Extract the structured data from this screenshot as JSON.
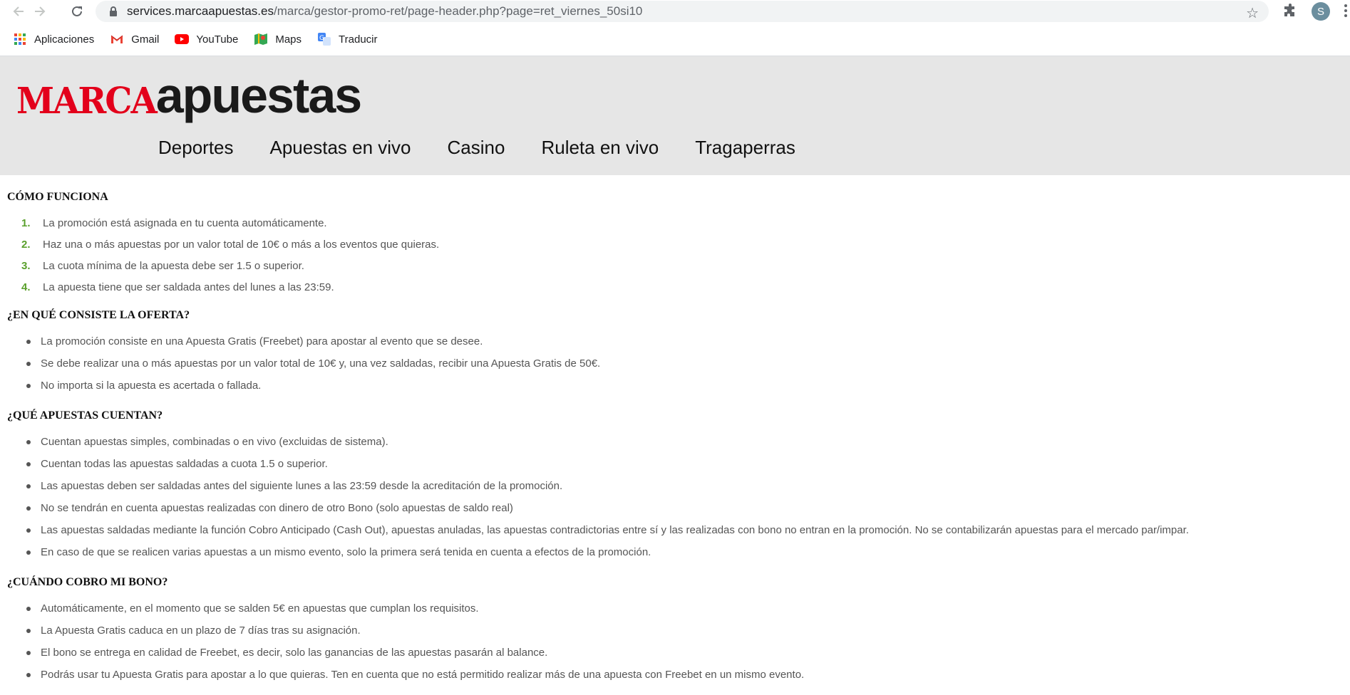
{
  "browser": {
    "url_host": "services.marcaapuestas.es",
    "url_path": "/marca/gestor-promo-ret/page-header.php?page=ret_viernes_50si10",
    "profile_initial": "S",
    "icons": [
      "back-arrow-icon",
      "forward-arrow-icon",
      "reload-icon",
      "lock-icon",
      "star-icon",
      "extensions-icon",
      "menu-kebab-icon"
    ]
  },
  "bookmarks": [
    {
      "label": "Aplicaciones",
      "icon": "apps-grid-icon"
    },
    {
      "label": "Gmail",
      "icon": "gmail-icon"
    },
    {
      "label": "YouTube",
      "icon": "youtube-icon"
    },
    {
      "label": "Maps",
      "icon": "maps-icon"
    },
    {
      "label": "Traducir",
      "icon": "translate-icon"
    }
  ],
  "site": {
    "logo_part1": "MARCA",
    "logo_part2": "apuestas",
    "menu": [
      "Deportes",
      "Apuestas en vivo",
      "Casino",
      "Ruleta en vivo",
      "Tragaperras"
    ],
    "colors": {
      "brand_red": "#e3001b",
      "header_bg": "#e6e6e6",
      "step_green": "#5aa02c"
    }
  },
  "sections": {
    "como": {
      "title": "CÓMO FUNCIONA",
      "steps": [
        {
          "num": "1.",
          "text": "La promoción está asignada en tu cuenta automáticamente."
        },
        {
          "num": "2.",
          "text": "Haz una o más apuestas por un valor total de 10€ o más a los eventos que quieras."
        },
        {
          "num": "3.",
          "text": "La cuota mínima de la apuesta debe ser 1.5 o superior."
        },
        {
          "num": "4.",
          "text": "La apuesta tiene que ser saldada antes del lunes a las 23:59."
        }
      ]
    },
    "oferta": {
      "title": "¿EN QUÉ CONSISTE LA OFERTA?",
      "items": [
        "La promoción consiste en una Apuesta Gratis (Freebet) para apostar al evento que se desee.",
        "Se debe realizar una o más apuestas por un valor total de 10€ y, una vez saldadas, recibir una Apuesta Gratis de 50€.",
        "No importa si la apuesta es acertada o fallada."
      ]
    },
    "cuentan": {
      "title": "¿QUÉ APUESTAS CUENTAN?",
      "items": [
        "Cuentan apuestas simples, combinadas o en vivo (excluidas de sistema).",
        "Cuentan todas las apuestas saldadas a cuota 1.5 o superior.",
        "Las apuestas deben ser saldadas antes del siguiente lunes a las 23:59 desde la acreditación de la promoción.",
        "No se tendrán en cuenta apuestas realizadas con dinero de otro Bono (solo apuestas de saldo real)",
        "Las apuestas saldadas mediante la función Cobro Anticipado (Cash Out), apuestas anuladas, las apuestas contradictorias entre sí y las realizadas con bono no entran en la promoción. No se contabilizarán apuestas para el mercado par/impar.",
        "En caso de que se realicen varias apuestas a un mismo evento, solo la primera será tenida en cuenta a efectos de la promoción."
      ]
    },
    "cobro": {
      "title": "¿CUÁNDO COBRO MI BONO?",
      "items": [
        "Automáticamente, en el momento que se salden 5€ en apuestas que cumplan los requisitos.",
        "La Apuesta Gratis caduca en un plazo de 7 días tras su asignación.",
        "El bono se entrega en calidad de Freebet, es decir, solo las ganancias de las apuestas pasarán al balance.",
        "Podrás usar tu Apuesta Gratis para apostar a lo que quieras. Ten en cuenta que no está permitido realizar más de una apuesta con Freebet en un mismo evento."
      ]
    }
  }
}
